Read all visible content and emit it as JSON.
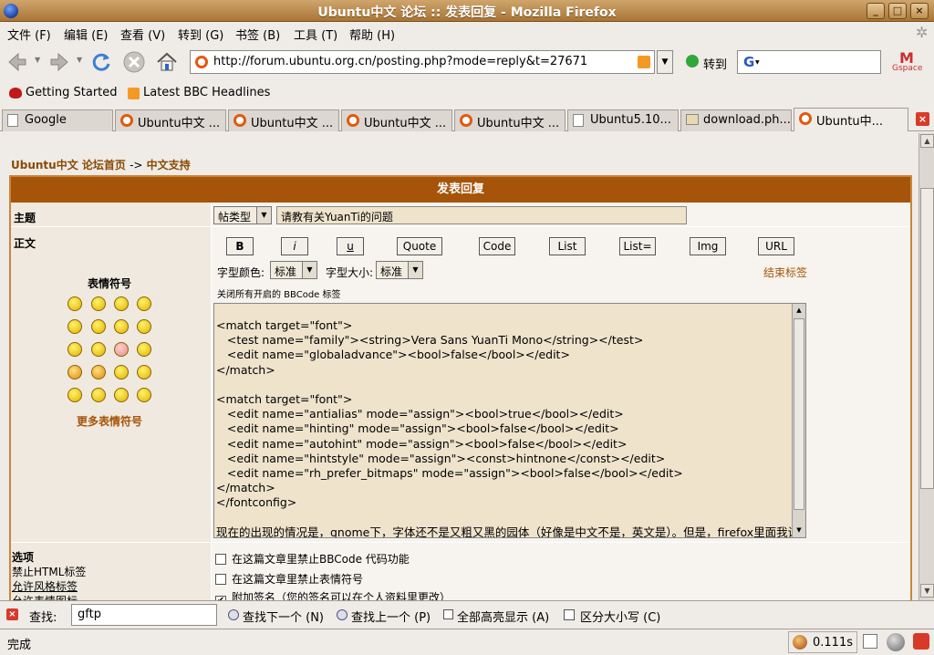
{
  "window": {
    "title": "Ubuntu中文 论坛 :: 发表回复 - Mozilla Firefox",
    "minimize": "_",
    "maximize": "□",
    "close": "×"
  },
  "menu": [
    "文件 (F)",
    "编辑 (E)",
    "查看 (V)",
    "转到 (G)",
    "书签 (B)",
    "工具 (T)",
    "帮助 (H)"
  ],
  "nav": {
    "url": "http://forum.ubuntu.org.cn/posting.php?mode=reply&t=27671",
    "go_label": "转到",
    "search_engine": "G",
    "gspace": "Gspace"
  },
  "bookmarks": [
    "Getting Started",
    "Latest BBC Headlines"
  ],
  "tabs": [
    "Google",
    "Ubuntu中文 ...",
    "Ubuntu中文 ...",
    "Ubuntu中文 ...",
    "Ubuntu中文 ...",
    "Ubuntu5.10...",
    "download.ph...",
    "Ubuntu中..."
  ],
  "breadcrumb": {
    "home": "Ubuntu中文 论坛首页",
    "sep": "->",
    "forum": "中文支持"
  },
  "form": {
    "header": "发表回复",
    "subject_label": "主题",
    "post_type": "帖类型",
    "subject_value": "请教有关YuanTi的问题",
    "body_label": "正文",
    "smileys_title": "表情符号",
    "more_smileys": "更多表情符号",
    "bbcode_buttons": [
      "B",
      "i",
      "u",
      "Quote",
      "Code",
      "List",
      "List=",
      "Img",
      "URL"
    ],
    "font_color_label": "字型颜色:",
    "font_color_value": "标准",
    "font_size_label": "字型大小:",
    "font_size_value": "标准",
    "close_tags": "结束标签",
    "hint": "关闭所有开启的 BBCode 标签",
    "body_text": "<match target=\"font\">\n   <test name=\"family\"><string>Vera Sans YuanTi Mono</string></test>\n   <edit name=\"globaladvance\"><bool>false</bool></edit>\n</match>\n\n<match target=\"font\">\n   <edit name=\"antialias\" mode=\"assign\"><bool>true</bool></edit>\n   <edit name=\"hinting\" mode=\"assign\"><bool>false</bool></edit>\n   <edit name=\"autohint\" mode=\"assign\"><bool>false</bool></edit>\n   <edit name=\"hintstyle\" mode=\"assign\"><const>hintnone</const></edit>\n   <edit name=\"rh_prefer_bitmaps\" mode=\"assign\"><bool>false</bool></edit>\n</match>\n</fontconfig>\n\n现在的出现的情况是，gnome下，字体还不是又粗又黑的园体（好像是中文不是，英文是）。但是，firefox里面我设",
    "options_label": "选项",
    "options_left": [
      "禁止HTML标签",
      "允许风格标签",
      "允许表情图标"
    ],
    "options": [
      {
        "label": "在这篇文章里禁止BBCode 代码功能",
        "checked": false
      },
      {
        "label": "在这篇文章里禁止表情符号",
        "checked": false
      },
      {
        "label": "附加签名（您的签名可以在个人资料里更改）",
        "checked": true
      }
    ]
  },
  "findbar": {
    "label": "查找:",
    "value": "gftp",
    "next": "查找下一个 (N)",
    "prev": "查找上一个 (P)",
    "highlight": "全部高亮显示 (A)",
    "match_case": "区分大小写 (C)"
  },
  "status": {
    "text": "完成",
    "timing": "0.111s"
  },
  "colors": {
    "titlebar": "#b98446",
    "accent": "#a55409",
    "link": "#8a4a00"
  }
}
